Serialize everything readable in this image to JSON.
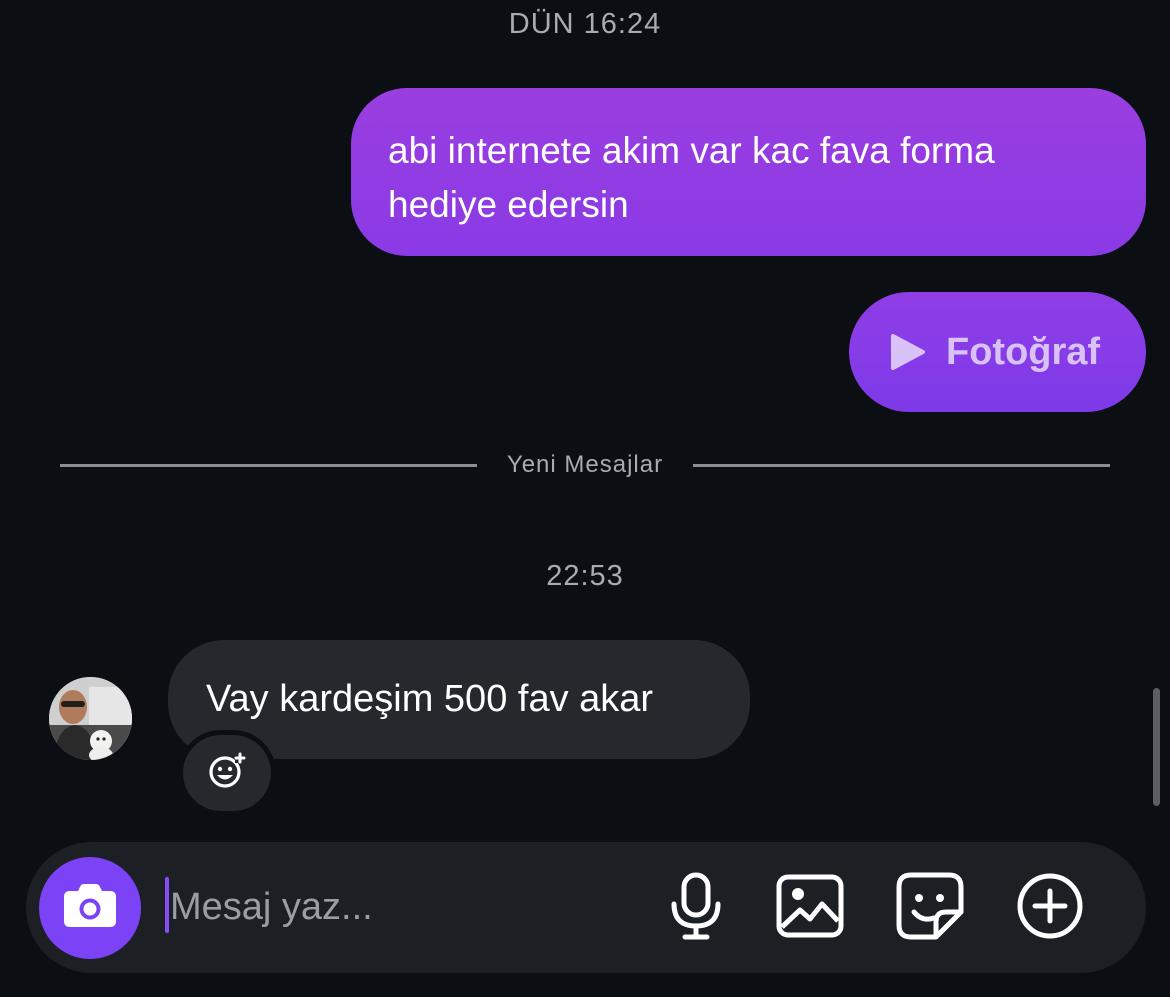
{
  "chat": {
    "timestamp_top": "DÜN 16:24",
    "outgoing_message": "abi internete akim var kac fava forma hediye edersin",
    "outgoing_photo_label": "Fotoğraf",
    "new_messages_divider": "Yeni Mesajlar",
    "timestamp_mid": "22:53",
    "incoming_message": "Vay kardeşim 500 fav akar"
  },
  "composer": {
    "placeholder": "Mesaj yaz...",
    "value": ""
  },
  "icons": {
    "photo_play": "play-icon",
    "reaction": "add-emoji-reaction-icon",
    "camera": "camera-icon",
    "mic": "microphone-icon",
    "gallery": "gallery-icon",
    "sticker": "sticker-icon",
    "more": "plus-circle-icon"
  },
  "colors": {
    "background": "#0b0e13",
    "outgoing_bubble": "#9a3ee0",
    "incoming_bubble": "#25282d",
    "camera_button": "#7b42f6",
    "composer": "#1c1f24"
  }
}
